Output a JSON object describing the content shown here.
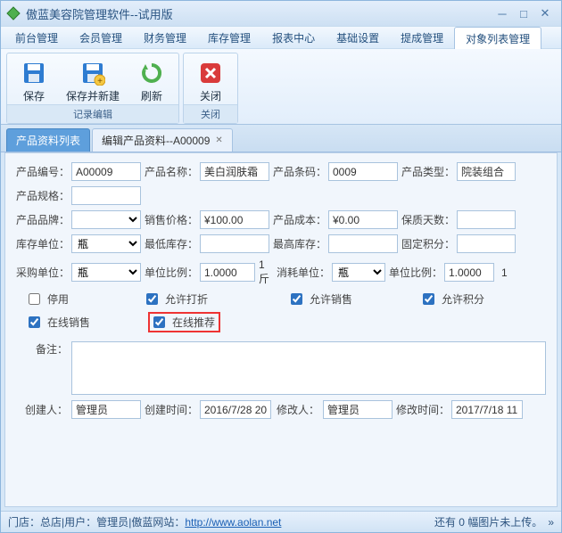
{
  "window": {
    "title": "傲蓝美容院管理软件--试用版"
  },
  "menu": {
    "items": [
      "前台管理",
      "会员管理",
      "财务管理",
      "库存管理",
      "报表中心",
      "基础设置",
      "提成管理",
      "对象列表管理"
    ],
    "active": 7
  },
  "ribbon": {
    "group1": {
      "label": "记录编辑",
      "buttons": {
        "save": "保存",
        "saveNew": "保存并新建",
        "refresh": "刷新"
      }
    },
    "group2": {
      "label": "关闭",
      "buttons": {
        "close": "关闭"
      }
    }
  },
  "doctabs": {
    "items": [
      {
        "label": "产品资料列表",
        "active": true
      },
      {
        "label": "编辑产品资料--A00009",
        "active": false
      }
    ]
  },
  "form": {
    "labels": {
      "code": "产品编号：",
      "name": "产品名称：",
      "barcode": "产品条码：",
      "type": "产品类型：",
      "spec": "产品规格：",
      "brand": "产品品牌：",
      "price": "销售价格：",
      "cost": "产品成本：",
      "shelf": "保质天数：",
      "stockUnit": "库存单位：",
      "minStock": "最低库存：",
      "maxStock": "最高库存：",
      "fixedPoints": "固定积分：",
      "purchaseUnit": "采购单位：",
      "unitRatio1": "单位比例：",
      "consumeUnitPfx": "1斤",
      "consumeUnit": "消耗单位：",
      "unitRatio2": "单位比例：",
      "unitSuffix": "1",
      "disabled": "停用",
      "allowDiscount": "允许打折",
      "allowSale": "允许销售",
      "allowPoints": "允许积分",
      "onlineSale": "在线销售",
      "onlineRec": "在线推荐",
      "remark": "备注：",
      "creator": "创建人：",
      "createTime": "创建时间：",
      "modifier": "修改人：",
      "modifyTime": "修改时间："
    },
    "values": {
      "code": "A00009",
      "name": "美白润肤霜",
      "barcode": "0009",
      "type": "院装组合",
      "spec": "",
      "brand": "",
      "price": "¥100.00",
      "cost": "¥0.00",
      "shelf": "",
      "stockUnit": "瓶",
      "minStock": "",
      "maxStock": "",
      "fixedPoints": "",
      "purchaseUnit": "瓶",
      "unitRatio1": "1.0000",
      "consumeUnit": "瓶",
      "unitRatio2": "1.0000",
      "remark": "",
      "creator": "管理员",
      "createTime": "2016/7/28 20",
      "modifier": "管理员",
      "modifyTime": "2017/7/18 11"
    },
    "checks": {
      "disabled": false,
      "allowDiscount": true,
      "allowSale": true,
      "allowPoints": true,
      "onlineSale": true,
      "onlineRec": true
    }
  },
  "status": {
    "store_l": "门店：",
    "store": "总店",
    "sep": " | ",
    "user_l": "用户：",
    "user": "管理员",
    "site_l": "傲蓝网站：",
    "url": "http://www.aolan.net",
    "right": "还有 0 幅图片未上传。"
  }
}
